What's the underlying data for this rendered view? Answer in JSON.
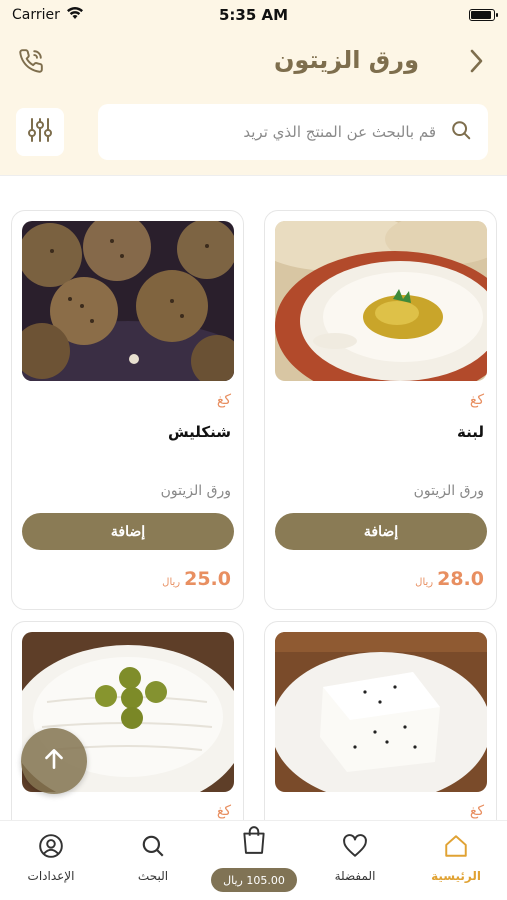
{
  "status_bar": {
    "carrier": "Carrier",
    "time": "5:35 AM"
  },
  "header": {
    "title": "ورق الزيتون"
  },
  "search": {
    "placeholder": "قم بالبحث عن المنتج الذي تريد"
  },
  "products": [
    {
      "unit": "كغ",
      "name": "لبنة",
      "vendor": "ورق الزيتون",
      "add_label": "إضافة",
      "price": "28.0",
      "currency": "ريال"
    },
    {
      "unit": "كغ",
      "name": "شنكليش",
      "vendor": "ورق الزيتون",
      "add_label": "إضافة",
      "price": "25.0",
      "currency": "ريال"
    },
    {
      "unit": "كغ"
    },
    {
      "unit": "كغ"
    }
  ],
  "nav": {
    "home": "الرئيسية",
    "favorites": "المفضلة",
    "cart_total": "105.00 ريال",
    "search": "البحث",
    "settings": "الإعدادات"
  },
  "colors": {
    "brand": "#8a7b55",
    "accent": "#e88f61",
    "active_nav": "#e0a233",
    "header_bg": "#fdf6e6"
  },
  "icons": [
    "wifi-icon",
    "battery-icon",
    "phone-icon",
    "back-chevron-icon",
    "filter-icon",
    "search-icon",
    "arrow-up-icon",
    "home-icon",
    "heart-icon",
    "bag-icon",
    "search-icon",
    "user-icon"
  ]
}
